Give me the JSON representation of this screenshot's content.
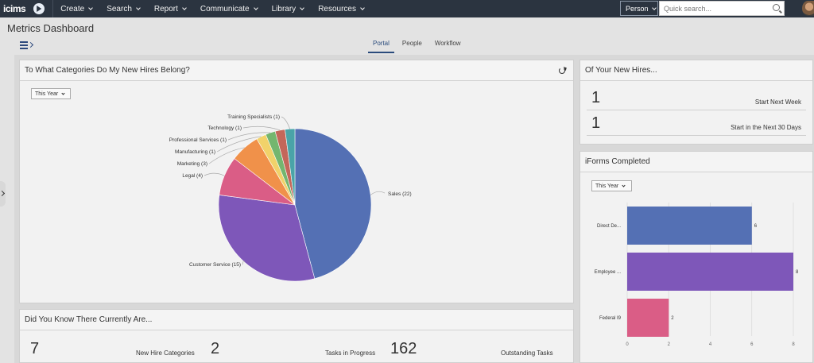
{
  "nav": {
    "logo": "icims",
    "items": [
      {
        "label": "Create"
      },
      {
        "label": "Search"
      },
      {
        "label": "Report"
      },
      {
        "label": "Communicate"
      },
      {
        "label": "Library"
      },
      {
        "label": "Resources"
      }
    ],
    "search_scope": "Person",
    "search_placeholder": "Quick search..."
  },
  "page": {
    "title": "Metrics Dashboard",
    "tabs": [
      {
        "label": "Portal",
        "active": true
      },
      {
        "label": "People",
        "active": false
      },
      {
        "label": "Workflow",
        "active": false
      }
    ]
  },
  "panels": {
    "categories": {
      "title": "To What Categories Do My New Hires Belong?",
      "filter": "This Year"
    },
    "new_hires": {
      "title": "Of Your New Hires...",
      "rows": [
        {
          "value": "1",
          "label": "Start Next Week"
        },
        {
          "value": "1",
          "label": "Start in the Next 30 Days"
        }
      ]
    },
    "iforms": {
      "title": "iForms Completed",
      "filter": "This Year"
    },
    "did_you_know": {
      "title": "Did You Know There Currently Are...",
      "stats": [
        {
          "value": "7",
          "label": "New Hire Categories"
        },
        {
          "value": "2",
          "label": "Tasks in Progress"
        },
        {
          "value": "162",
          "label": "Outstanding Tasks"
        }
      ]
    }
  },
  "chart_data": [
    {
      "type": "pie",
      "title": "To What Categories Do My New Hires Belong?",
      "slices": [
        {
          "label": "Sales (22)",
          "value": 22,
          "color": "#5470b4"
        },
        {
          "label": "Customer Service (15)",
          "value": 15,
          "color": "#7e57b9"
        },
        {
          "label": "Legal (4)",
          "value": 4,
          "color": "#da5d86"
        },
        {
          "label": "Marketing (3)",
          "value": 3,
          "color": "#f0914a"
        },
        {
          "label": "Manufacturing (1)",
          "value": 1,
          "color": "#f1d26a"
        },
        {
          "label": "Professional Services (1)",
          "value": 1,
          "color": "#74b66f"
        },
        {
          "label": "Technology (1)",
          "value": 1,
          "color": "#c4675a"
        },
        {
          "label": "Training Specialists (1)",
          "value": 1,
          "color": "#4aa4a8"
        }
      ]
    },
    {
      "type": "bar",
      "orientation": "horizontal",
      "title": "iForms Completed",
      "categories": [
        "Direct De...",
        "Employee ...",
        "Federal I9"
      ],
      "values": [
        6,
        8,
        2
      ],
      "colors": [
        "#5470b4",
        "#7e57b9",
        "#da5d86"
      ],
      "xlim": [
        0,
        8
      ],
      "xticks": [
        "0",
        "2",
        "4",
        "6",
        "8"
      ]
    }
  ]
}
